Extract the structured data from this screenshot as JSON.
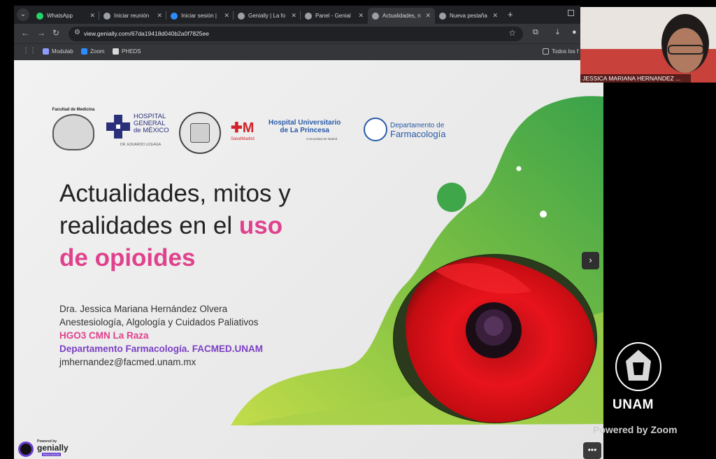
{
  "browser": {
    "tabs": [
      {
        "title": "WhatsApp",
        "color": "#25d366",
        "active": false
      },
      {
        "title": "Iniciar reunión",
        "color": "#9aa0a6",
        "active": false
      },
      {
        "title": "Iniciar sesión |",
        "color": "#2d8cff",
        "active": false
      },
      {
        "title": "Genially | La fo",
        "color": "#9aa0a6",
        "active": false
      },
      {
        "title": "Panel - Genial",
        "color": "#9aa0a6",
        "active": false
      },
      {
        "title": "Actualidades, n",
        "color": "#9aa0a6",
        "active": true
      },
      {
        "title": "Nueva pestaña",
        "color": "#9aa0a6",
        "active": false
      }
    ],
    "url": "view.genially.com/67da19418d040b2a0f7825ee",
    "bookmarks": [
      {
        "label": "Modulab"
      },
      {
        "label": "Zoom"
      },
      {
        "label": "PHEDS"
      }
    ],
    "bookmarks_right": "Todos los f"
  },
  "slide": {
    "logos": {
      "facmed": "Facultad de Medicina",
      "hgm_line1": "HOSPITAL",
      "hgm_line2": "GENERAL",
      "hgm_line3": "de MÉXICO",
      "hgm_sub": "DR. EDUARDO LICEAGA",
      "princesa_line1": "Hospital Universitario",
      "princesa_line2": "de La Princesa",
      "princesa_sub": "Comunidad de Madrid",
      "salud_madrid": "SaludMadrid",
      "farma_line1": "Departamento de",
      "farma_line2": "Farmacología"
    },
    "title_line1": "Actualidades, mitos y",
    "title_line2_plain": "realidades en el ",
    "title_line2_hl": "uso",
    "title_line3_hl": "de opioides",
    "author": "Dra. Jessica Mariana Hernández Olvera",
    "specialty": "Anestesiología, Algología y Cuidados Paliativos",
    "hospital": "HGO3 CMN La Raza",
    "department": "Departamento Farmacología. FACMED.UNAM",
    "email": "jmhernandez@facmed.unam.mx",
    "genially_powered": "Powered by",
    "genially_name": "genially",
    "genially_edu": "EDUCATION"
  },
  "zoom": {
    "participant_name": "JESSICA MARIANA HERNANDEZ ...",
    "org_name": "UNAM",
    "powered_by": "Powered by Zoom"
  },
  "colors": {
    "accent_pink": "#e0418c",
    "accent_purple": "#7b3fc4",
    "blob_green": "#7bc043"
  }
}
